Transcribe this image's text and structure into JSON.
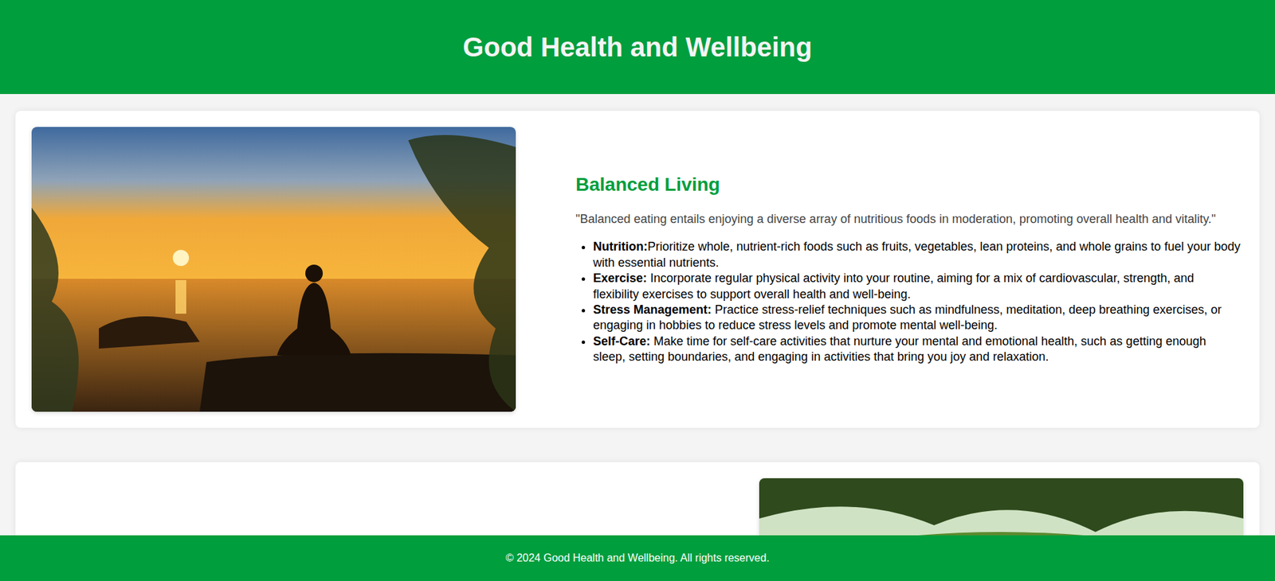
{
  "header": {
    "title": "Good Health and Wellbeing"
  },
  "sections": [
    {
      "kind": "image-left",
      "heading": "Balanced Living",
      "quote": "\"Balanced eating entails enjoying a diverse array of nutritious foods in moderation, promoting overall health and vitality.\"",
      "items": [
        {
          "label": "Nutrition:",
          "text": "Prioritize whole, nutrient-rich foods such as fruits, vegetables, lean proteins, and whole grains to fuel your body with essential nutrients."
        },
        {
          "label": "Exercise:",
          "text": " Incorporate regular physical activity into your routine, aiming for a mix of cardiovascular, strength, and flexibility exercises to support overall health and well-being."
        },
        {
          "label": "Stress Management:",
          "text": " Practice stress-relief techniques such as mindfulness, meditation, deep breathing exercises, or engaging in hobbies to reduce stress levels and promote mental well-being."
        },
        {
          "label": "Self-Care:",
          "text": " Make time for self-care activities that nurture your mental and emotional health, such as getting enough sleep, setting boundaries, and engaging in activities that bring you joy and relaxation."
        }
      ]
    },
    {
      "kind": "image-right"
    }
  ],
  "footer": {
    "text": "© 2024 Good Health and Wellbeing. All rights reserved."
  }
}
